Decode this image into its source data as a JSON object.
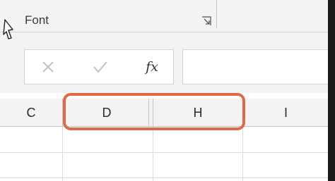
{
  "ribbon": {
    "group_label": "Font",
    "launcher_icon": "dialog-launcher-icon"
  },
  "formula_bar": {
    "cancel_icon": "x-icon",
    "enter_icon": "checkmark-icon",
    "insert_function_label": "fx",
    "formula_value": ""
  },
  "column_headers": [
    "C",
    "D",
    "H",
    "I"
  ],
  "highlight": {
    "color": "#de6a48",
    "columns": [
      "D",
      "H"
    ]
  },
  "colors": {
    "ribbon_bg": "#f3f3f3",
    "gridline": "#dcdcdc",
    "header_border": "#c6c6c6"
  }
}
